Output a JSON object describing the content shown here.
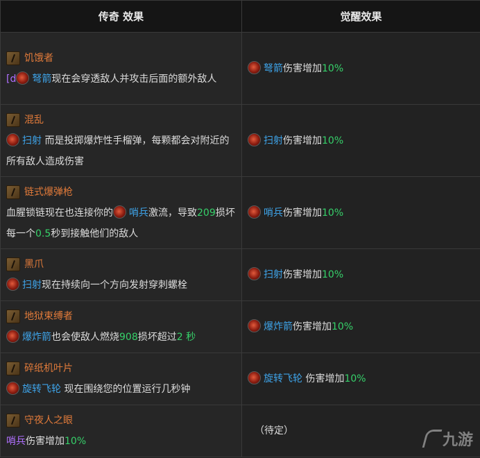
{
  "header": {
    "col1": "传奇 效果",
    "col2": "觉醒效果"
  },
  "rows": [
    {
      "name": "饥饿者",
      "legendary": {
        "prefix": "[d",
        "skill": "弩箭",
        "text": "现在会穿透敌人并攻击后面的额外敌人"
      },
      "awakened": {
        "skill": "弩箭",
        "text": "伤害增加",
        "num": "10%"
      }
    },
    {
      "name": "混乱",
      "legendary": {
        "skill": "扫射",
        "text": " 而是投掷爆炸性手榴弹，每颗都会对附近的所有敌人造成伤害"
      },
      "awakened": {
        "skill": "扫射",
        "text": "伤害增加",
        "num": "10%"
      }
    },
    {
      "name": "链式爆弹枪",
      "legendary": {
        "pre": "血腥锁链现在也连接你的",
        "skill": "哨兵",
        "mid": "激流，导致",
        "num1": "209",
        "mid2": "损坏每一个",
        "num2": "0.5",
        "post": "秒到接触他们的敌人"
      },
      "awakened": {
        "skill": "哨兵",
        "text": "伤害增加",
        "num": "10%"
      }
    },
    {
      "name": "黑爪",
      "legendary": {
        "skill": "扫射",
        "text": "现在持续向一个方向发射穿刺螺栓"
      },
      "awakened": {
        "skill": "扫射",
        "text": "伤害增加",
        "num": "10%"
      }
    },
    {
      "name": "地狱束缚者",
      "legendary": {
        "skill": "爆炸箭",
        "mid": "也会使敌人燃烧",
        "num1": "908",
        "mid2": "损坏超过",
        "num2": "2 秒"
      },
      "awakened": {
        "skill": "爆炸箭",
        "text": "伤害增加",
        "num": "10%"
      }
    },
    {
      "name": "碎纸机叶片",
      "legendary": {
        "skill": "旋转飞轮",
        "text": " 现在围绕您的位置运行几秒钟"
      },
      "awakened": {
        "skill": "旋转飞轮",
        "text": " 伤害增加",
        "num": "10%"
      }
    },
    {
      "name": "守夜人之眼",
      "legendary": {
        "skill": "哨兵",
        "text": "伤害增加",
        "num": "10%"
      },
      "awakened": {
        "text": "（待定）"
      }
    }
  ],
  "watermark": "九游"
}
